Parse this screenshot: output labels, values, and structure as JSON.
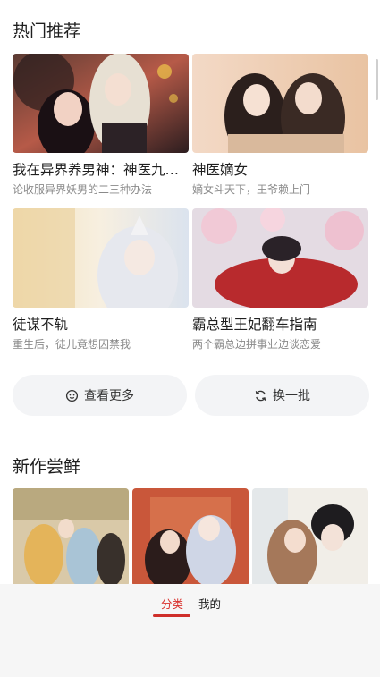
{
  "hot": {
    "title": "热门推荐",
    "items": [
      {
        "title": "我在异界养男神：神医九小姐",
        "sub": "论收服异界妖男的二三种办法"
      },
      {
        "title": "神医嫡女",
        "sub": "嫡女斗天下，王爷赖上门"
      },
      {
        "title": "徒谋不轨",
        "sub": "重生后，徒儿竟想囚禁我"
      },
      {
        "title": "霸总型王妃翻车指南",
        "sub": "两个霸总边拼事业边谈恋爱"
      }
    ],
    "more_label": "查看更多",
    "refresh_label": "换一批"
  },
  "new": {
    "title": "新作尝鲜"
  },
  "bottom_nav": {
    "tabs": [
      {
        "label": "分类",
        "active": true
      },
      {
        "label": "我的",
        "active": false
      }
    ]
  },
  "colors": {
    "accent": "#d9302c",
    "button_bg": "#f3f4f6"
  }
}
